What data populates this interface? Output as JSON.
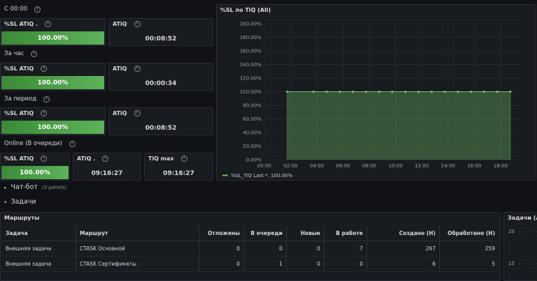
{
  "rows": {
    "since_midnight": "С 00:00",
    "per_hour": "За час",
    "per_period": "За период",
    "online": "Online (В очереди)"
  },
  "stats": {
    "r1_sl_title": "%SL ATiQ .",
    "r1_sl_value": "100.00%",
    "r1_atiq_title": "ATiQ",
    "r1_atiq_value": "00:08:52",
    "r2_sl_title": "%SL ATiQ",
    "r2_sl_value": "100.00%",
    "r2_atiq_title": "ATiQ",
    "r2_atiq_value": "00:00:34",
    "r3_sl_title": "%SL ATiQ",
    "r3_sl_value": "100.00%",
    "r3_atiq_title": "ATiQ",
    "r3_atiq_value": "00:08:52",
    "r4_sl_title": "%SL ATiQ",
    "r4_sl_value": "100.00%",
    "r4_atiq_title": "ATiQ .",
    "r4_atiq_value": "09:16:27",
    "r4_tiq_title": "TiQ max",
    "r4_tiq_value": "09:16:27"
  },
  "gauge_level": 1.0,
  "chart_panel": {
    "title": "%SL по TiQ (All)",
    "legend_text": "%SL_TiQ  Last *: 100.00%"
  },
  "chart_data": {
    "type": "area",
    "series": [
      {
        "name": "%SL_TiQ",
        "x": [
          "01:45",
          "03:45",
          "04:45",
          "05:45",
          "06:45",
          "07:45",
          "08:45",
          "09:45",
          "10:45",
          "11:45",
          "12:45",
          "13:45",
          "14:45",
          "15:45",
          "16:45",
          "17:45",
          "18:45"
        ],
        "values": [
          100,
          100,
          100,
          100,
          100,
          100,
          100,
          100,
          100,
          100,
          100,
          100,
          100,
          100,
          100,
          100,
          100
        ]
      }
    ],
    "ylim": [
      0,
      200
    ],
    "y_ticks": [
      "0.00%",
      "20.00%",
      "40.00%",
      "60.00%",
      "80.00%",
      "100.00%",
      "120.00%",
      "140.00%",
      "160.00%",
      "180.00%",
      "200.00%"
    ],
    "x_ticks": [
      "00:00",
      "02:00",
      "04:00",
      "06:00",
      "08:00",
      "10:00",
      "12:00",
      "14:00",
      "16:00",
      "18:00"
    ],
    "xlim": [
      "00:00",
      "19:30"
    ],
    "legend_placement": "bottom-left",
    "color": "#73bf69",
    "grid": true
  },
  "chatbot": {
    "label": "Чат-бот",
    "count": "(3 panels)"
  },
  "tasks": {
    "label": "Задачи"
  },
  "routes": {
    "title": "Маршруты",
    "columns": [
      "Задача",
      "Маршрут",
      "Отложены",
      "В очереди",
      "Новые",
      "В работе",
      "Создано (Н)",
      "Обработано (Н)"
    ],
    "rows": [
      [
        "Внешняя задача",
        "CTASK Основной",
        "0",
        "0",
        "0",
        "7",
        "267",
        "259"
      ],
      [
        "Внешняя задача",
        "CTASK Сертификаты",
        "0",
        "1",
        "0",
        "0",
        "6",
        "5"
      ]
    ]
  },
  "side_panel": {
    "title": "Задачи (All",
    "y_tick_top": "20",
    "y_tick_mid": "15"
  },
  "colors": {
    "background": "#111217",
    "panel": "#181b1f",
    "green": "#73bf69",
    "gauge_dark": "#3c8a36"
  }
}
